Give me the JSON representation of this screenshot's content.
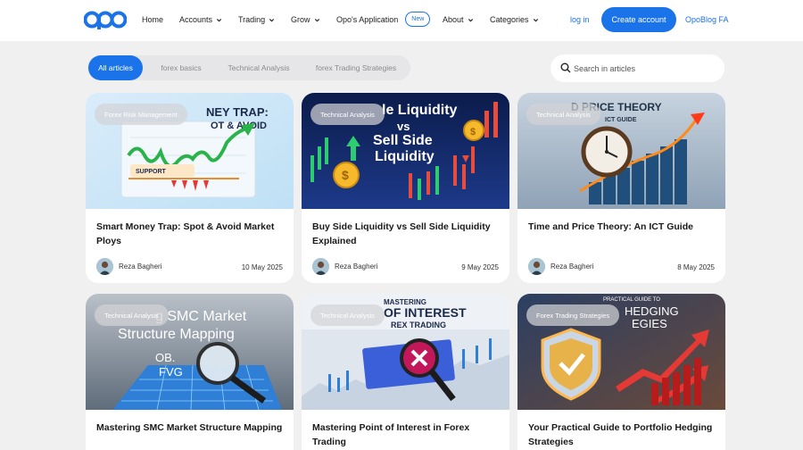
{
  "nav": {
    "logo_text": "opo",
    "items": [
      {
        "label": "Home"
      },
      {
        "label": "Accounts"
      },
      {
        "label": "Trading"
      },
      {
        "label": "Grow"
      },
      {
        "label": "Opo's Application"
      },
      {
        "label": "About"
      },
      {
        "label": "Categories"
      }
    ],
    "new_badge": "New",
    "login": "log in",
    "create_account": "Create account",
    "blog_fa": "OpoBlog FA"
  },
  "tabs": [
    {
      "label": "All articles",
      "active": true
    },
    {
      "label": "forex basics",
      "active": false
    },
    {
      "label": "Technical Analysis",
      "active": false
    },
    {
      "label": "forex Trading Strategies",
      "active": false
    }
  ],
  "search": {
    "placeholder": "Search in articles"
  },
  "colors": {
    "accent": "#1a73e8",
    "background": "#f0f0f1"
  },
  "cards": [
    {
      "category": "Forex Risk Management",
      "title": "Smart Money Trap: Spot & Avoid Market Ploys",
      "author": "Reza Bagheri",
      "date": "10 May 2025",
      "image_text": [
        "NEY TRAP:",
        "OT & AVOID",
        "SUPPORT"
      ]
    },
    {
      "category": "Technical Analysis",
      "title": "Buy Side Liquidity vs Sell Side Liquidity Explained",
      "author": "Reza Bagheri",
      "date": "9 May 2025",
      "image_text": [
        "le Liquidity",
        "vs",
        "Sell Side",
        "Liquidity"
      ]
    },
    {
      "category": "Technical Analysis",
      "title": "Time and Price Theory: An ICT Guide",
      "author": "Reza Bagheri",
      "date": "8 May 2025",
      "image_text": [
        "D PRICE THEORY",
        "ICT GUIDE"
      ]
    },
    {
      "category": "Technical Analysis",
      "title": "Mastering SMC Market Structure Mapping",
      "author": "",
      "date": "",
      "image_text": [
        "g SMC Market",
        "Structure Mapping",
        "OB.",
        "FVG"
      ]
    },
    {
      "category": "Technical Analysis",
      "title": "Mastering Point of Interest in Forex Trading",
      "author": "",
      "date": "",
      "image_text": [
        "MASTERING",
        "OF INTEREST",
        "REX TRADING"
      ]
    },
    {
      "category": "Forex Trading Strategies",
      "title": "Your Practical Guide to Portfolio Hedging Strategies",
      "author": "",
      "date": "",
      "image_text": [
        "PRACTICAL GUIDE TO",
        "HEDGING",
        "EGIES"
      ]
    }
  ]
}
